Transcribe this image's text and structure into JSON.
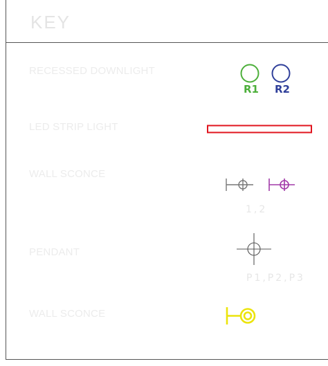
{
  "key": {
    "title": "KEY",
    "items": [
      {
        "label": "RECESSED DOWNLIGHT",
        "tags": [
          "R1",
          "R2"
        ]
      },
      {
        "label": "LED STRIP LIGHT"
      },
      {
        "label": "WALL SCONCE",
        "tag": "1,2"
      },
      {
        "label": "PENDANT",
        "tag": "P1,P2,P3"
      },
      {
        "label": "WALL SCONCE"
      }
    ]
  },
  "colors": {
    "r1": "#4caf3a",
    "r2": "#2f3f9a",
    "led_strip": "#e0141e",
    "sconce_grey": "#777777",
    "sconce_magenta": "#a23aa8",
    "pendant": "#555555",
    "sconce_yellow": "#ece40c",
    "faint_text": "#e6e6e6"
  }
}
